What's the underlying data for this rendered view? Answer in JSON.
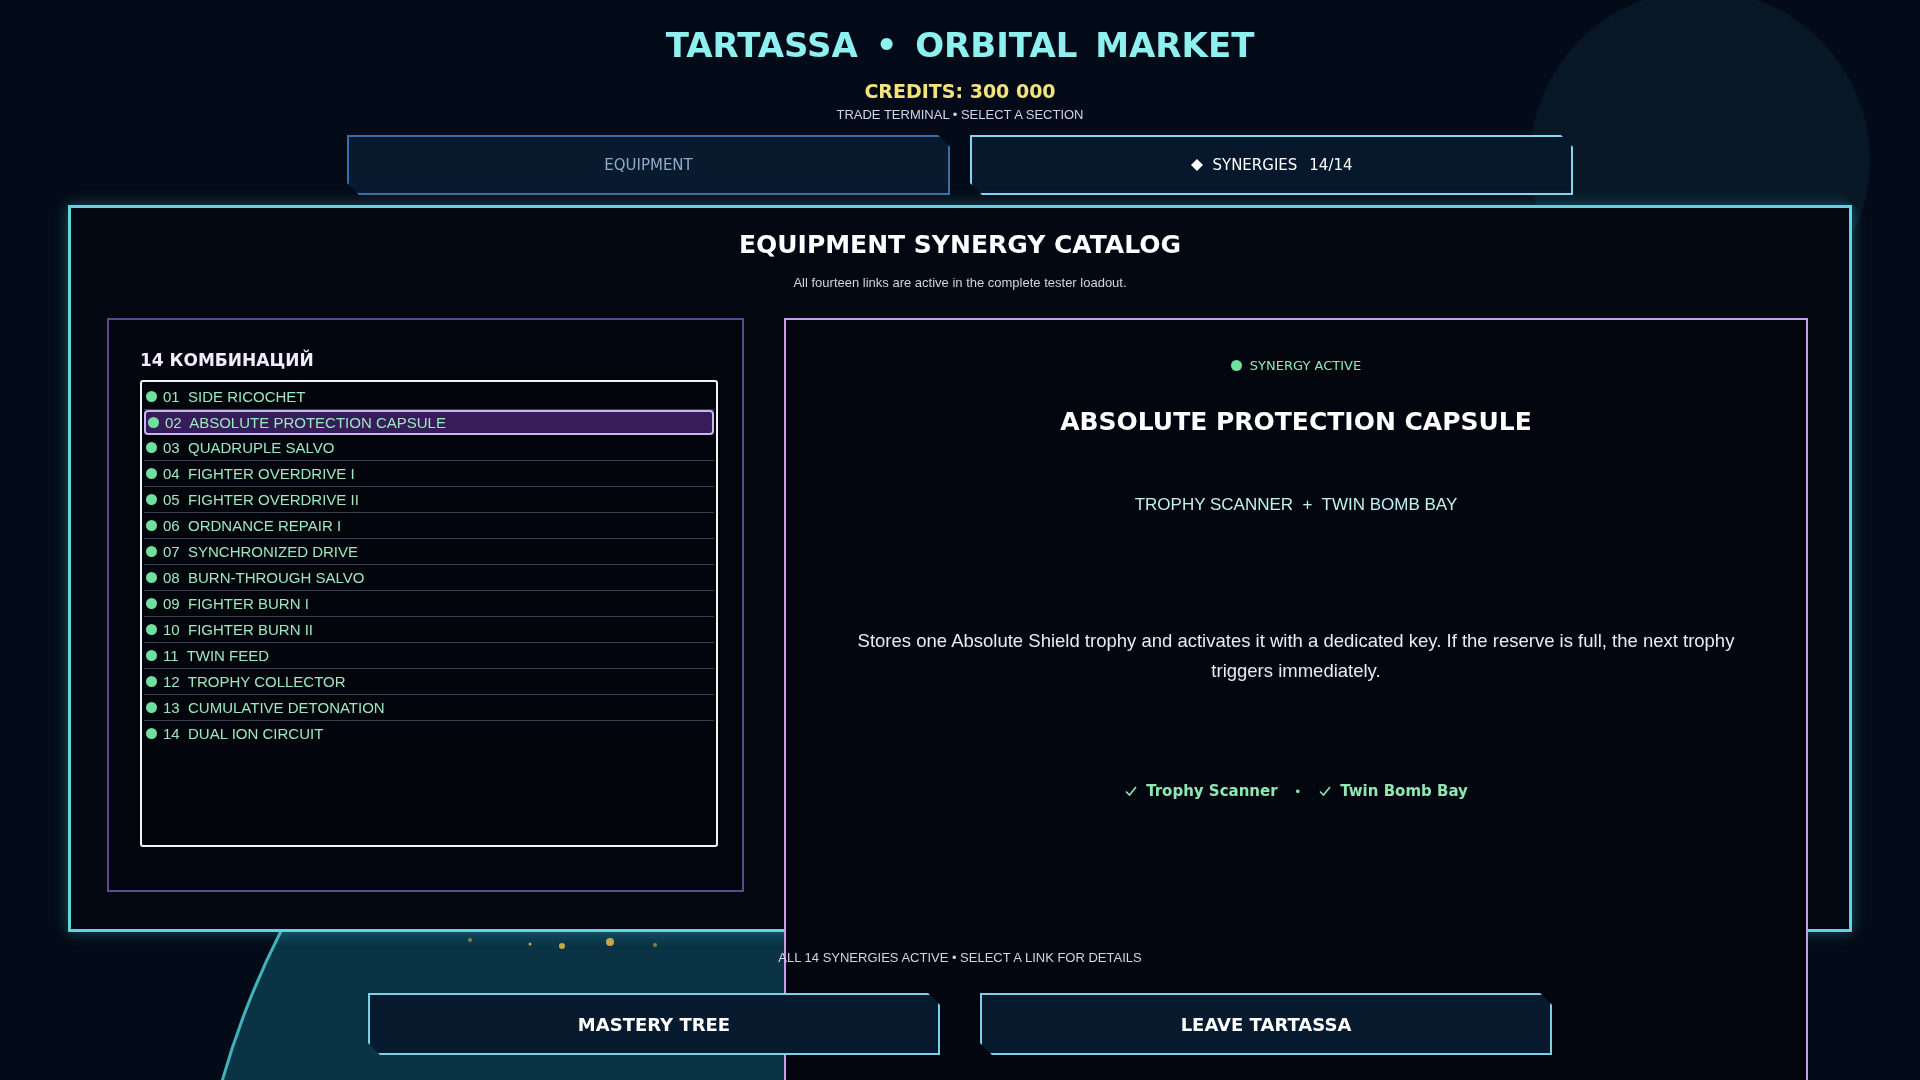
{
  "header": {
    "title": "TARTASSA • ORBITAL MARKET",
    "credits": "CREDITS: 300 000",
    "subtitle": "TRADE TERMINAL • SELECT A SECTION"
  },
  "tabs": [
    {
      "label": "EQUIPMENT",
      "selected": false
    },
    {
      "label": "SYNERGIES",
      "count": "14/14",
      "selected": true
    }
  ],
  "catalog": {
    "title": "EQUIPMENT SYNERGY CATALOG",
    "subtitle": "All fourteen links are active in the complete tester loadout."
  },
  "synergy_list": {
    "heading": "14 КОМБИНАЦИЙ",
    "items": [
      {
        "number": "01",
        "name": "SIDE RICOCHET",
        "active": true,
        "selected": false
      },
      {
        "number": "02",
        "name": "ABSOLUTE PROTECTION CAPSULE",
        "active": true,
        "selected": true
      },
      {
        "number": "03",
        "name": "QUADRUPLE SALVO",
        "active": true,
        "selected": false
      },
      {
        "number": "04",
        "name": "FIGHTER OVERDRIVE I",
        "active": true,
        "selected": false
      },
      {
        "number": "05",
        "name": "FIGHTER OVERDRIVE II",
        "active": true,
        "selected": false
      },
      {
        "number": "06",
        "name": "ORDNANCE REPAIR I",
        "active": true,
        "selected": false
      },
      {
        "number": "07",
        "name": "SYNCHRONIZED DRIVE",
        "active": true,
        "selected": false
      },
      {
        "number": "08",
        "name": "BURN-THROUGH SALVO",
        "active": true,
        "selected": false
      },
      {
        "number": "09",
        "name": "FIGHTER BURN I",
        "active": true,
        "selected": false
      },
      {
        "number": "10",
        "name": "FIGHTER BURN II",
        "active": true,
        "selected": false
      },
      {
        "number": "11",
        "name": "TWIN FEED",
        "active": true,
        "selected": false
      },
      {
        "number": "12",
        "name": "TROPHY COLLECTOR",
        "active": true,
        "selected": false
      },
      {
        "number": "13",
        "name": "CUMULATIVE DETONATION",
        "active": true,
        "selected": false
      },
      {
        "number": "14",
        "name": "DUAL ION CIRCUIT",
        "active": true,
        "selected": false
      }
    ]
  },
  "detail": {
    "status": {
      "label": "SYNERGY ACTIVE",
      "active": true
    },
    "title": "ABSOLUTE PROTECTION CAPSULE",
    "components": "TROPHY SCANNER  +  TWIN BOMB BAY",
    "description": "Stores one Absolute Shield trophy and activates it with a dedicated key. If the reserve is full, the next trophy triggers immediately.",
    "requirements": [
      {
        "label": "Trophy Scanner",
        "met": true
      },
      {
        "label": "Twin Bomb Bay",
        "met": true
      }
    ],
    "requirement_separator": "•"
  },
  "footer": {
    "status": "ALL 14 SYNERGIES ACTIVE • SELECT A LINK FOR DETAILS",
    "buttons": [
      "MASTERY TREE",
      "LEAVE TARTASSA"
    ]
  }
}
